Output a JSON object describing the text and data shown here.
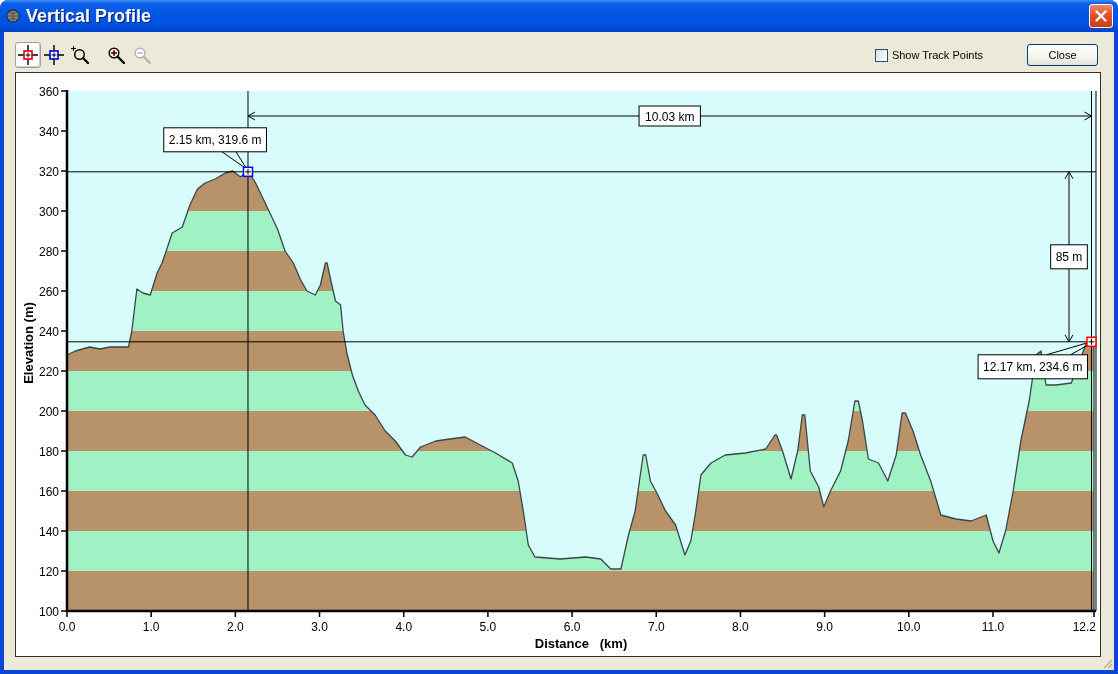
{
  "window": {
    "title": "Vertical Profile"
  },
  "toolbar": {
    "tools": [
      {
        "kind": "red_cursor",
        "selected": true,
        "disabled": false
      },
      {
        "kind": "blue_cursor",
        "selected": false,
        "disabled": false
      },
      {
        "kind": "zoom_area",
        "selected": false,
        "disabled": false
      },
      {
        "kind": "zoom_in",
        "selected": false,
        "disabled": false
      },
      {
        "kind": "zoom_out",
        "selected": false,
        "disabled": true
      }
    ],
    "show_track_points": {
      "label": "Show Track Points",
      "checked": false
    },
    "close_button": "Close"
  },
  "profile": {
    "chart_data": {
      "type": "area",
      "xlabel": "Distance   (km)",
      "ylabel": "Elevation (m)",
      "xlim": [
        0,
        12.2
      ],
      "ylim": [
        100,
        360
      ],
      "xticks": [
        {
          "value": 0,
          "label": "0.0"
        },
        {
          "value": 1,
          "label": "1.0"
        },
        {
          "value": 2,
          "label": "2.0"
        },
        {
          "value": 3,
          "label": "3.0"
        },
        {
          "value": 4,
          "label": "4.0"
        },
        {
          "value": 5,
          "label": "5.0"
        },
        {
          "value": 6,
          "label": "6.0"
        },
        {
          "value": 7,
          "label": "7.0"
        },
        {
          "value": 8,
          "label": "8.0"
        },
        {
          "value": 9,
          "label": "9.0"
        },
        {
          "value": 10,
          "label": "10.0"
        },
        {
          "value": 11,
          "label": "11.0"
        },
        {
          "value": 12.2,
          "label": "12.2"
        }
      ],
      "yticks": [
        100,
        120,
        140,
        160,
        180,
        200,
        220,
        240,
        260,
        280,
        300,
        320,
        340,
        360
      ],
      "x": [
        0,
        0.1,
        0.27,
        0.39,
        0.51,
        0.73,
        0.77,
        0.83,
        0.9,
        0.99,
        1.07,
        1.13,
        1.25,
        1.37,
        1.46,
        1.55,
        1.64,
        1.76,
        1.88,
        1.97,
        2.06,
        2.15,
        2.24,
        2.32,
        2.41,
        2.5,
        2.59,
        2.69,
        2.77,
        2.85,
        2.95,
        3.01,
        3.07,
        3.09,
        3.13,
        3.19,
        3.25,
        3.28,
        3.33,
        3.39,
        3.46,
        3.54,
        3.66,
        3.78,
        3.9,
        4.02,
        4.1,
        4.2,
        4.38,
        4.55,
        4.73,
        4.91,
        5.09,
        5.29,
        5.36,
        5.42,
        5.48,
        5.56,
        5.86,
        6.16,
        6.34,
        6.46,
        6.58,
        6.67,
        6.75,
        6.81,
        6.845,
        6.86,
        6.875,
        6.93,
        7.02,
        7.11,
        7.23,
        7.34,
        7.41,
        7.47,
        7.53,
        7.65,
        7.82,
        8.06,
        8.3,
        8.41,
        8.43,
        8.5,
        8.6,
        8.68,
        8.735,
        8.75,
        8.765,
        8.83,
        8.93,
        8.99,
        9.07,
        9.19,
        9.28,
        9.36,
        9.38,
        9.4,
        9.45,
        9.52,
        9.64,
        9.75,
        9.85,
        9.92,
        9.94,
        9.96,
        10.05,
        10.14,
        10.26,
        10.38,
        10.56,
        10.74,
        10.92,
        11.0,
        11.07,
        11.15,
        11.24,
        11.33,
        11.43,
        11.51,
        11.57,
        11.63,
        11.75,
        11.93,
        12.02,
        12.1,
        12.2
      ],
      "series": [
        {
          "color": "#3a4646",
          "values": [
            228,
            230,
            232,
            231,
            232,
            232,
            240,
            261,
            259,
            258,
            269,
            274,
            289,
            292,
            303,
            311,
            314,
            316,
            319,
            320,
            317,
            320,
            314,
            307,
            299,
            291,
            280,
            274,
            266,
            260,
            258,
            263,
            274,
            274,
            266,
            255,
            253,
            240,
            228,
            218,
            210,
            203,
            198,
            190,
            185,
            178,
            177,
            182,
            185,
            186,
            187,
            183,
            179,
            174,
            165,
            150,
            133,
            127,
            126,
            127,
            126,
            121,
            121,
            138,
            150,
            168,
            178,
            178,
            178,
            165,
            158,
            150,
            143,
            128,
            135,
            150,
            168,
            174,
            178,
            179,
            181,
            188,
            188,
            180,
            166,
            180,
            198,
            198,
            198,
            170,
            162,
            152,
            160,
            170,
            185,
            205,
            205,
            205,
            195,
            176,
            174,
            165,
            178,
            199,
            199,
            199,
            190,
            178,
            165,
            148,
            146,
            145,
            148,
            135,
            129,
            140,
            160,
            185,
            205,
            228,
            230,
            213,
            213,
            214,
            null,
            233,
            237
          ]
        }
      ],
      "annotations": [
        {
          "text": "2.15 km, 319.6 m",
          "x": 2.15,
          "y": 319.6
        },
        {
          "text": "12.17 km, 234.6 m",
          "x": 12.17,
          "y": 234.6
        },
        "10.03 km",
        "85 m"
      ]
    }
  }
}
